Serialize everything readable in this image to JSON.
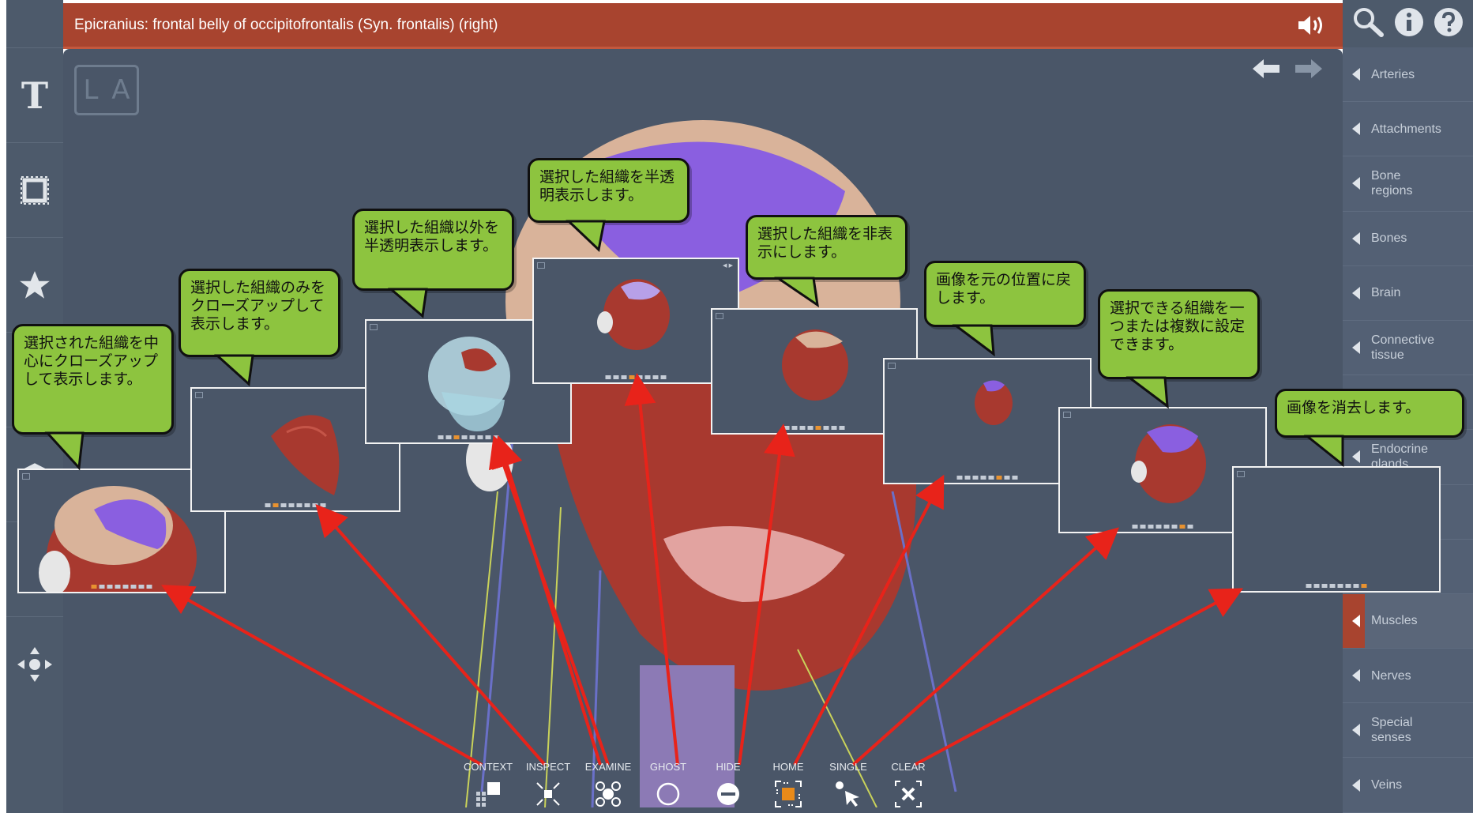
{
  "header": {
    "title": "Epicranius: frontal belly of occipitofrontalis (Syn. frontalis) (right)",
    "sound_icon": "speaker-icon"
  },
  "top_icons": [
    "search-icon",
    "info-icon",
    "help-icon"
  ],
  "left_toolbar": {
    "text_tool_label": "T",
    "items": [
      "text-icon",
      "frame-icon",
      "star-icon",
      "eye-icon",
      "layers-icon",
      "share-icon",
      "move-icon"
    ]
  },
  "viewport": {
    "badge": {
      "left": "L",
      "right": "A"
    }
  },
  "categories": [
    {
      "label": "Arteries"
    },
    {
      "label": "Attachments"
    },
    {
      "label": "Bone regions"
    },
    {
      "label": "Bones"
    },
    {
      "label": "Brain"
    },
    {
      "label": "Connective tissue"
    },
    {
      "label": ""
    },
    {
      "label": "Endocrine glands"
    },
    {
      "label": ""
    },
    {
      "label": ""
    },
    {
      "label": "Muscles"
    },
    {
      "label": "Nerves"
    },
    {
      "label": "Special senses"
    },
    {
      "label": "Veins"
    }
  ],
  "active_category": "Muscles",
  "callouts": {
    "context": "選択された組織を中心にクローズアップして表示します。",
    "inspect": "選択した組織のみをクローズアップして表示します。",
    "examine": "選択した組織以外を半透明表示します。",
    "ghost": "選択した組織を半透明表示します。",
    "hide": "選択した組織を非表示にします。",
    "home": "画像を元の位置に戻します。",
    "single": "選択できる組織を一つまたは複数に設定できます。",
    "clear": "画像を消去します。"
  },
  "toolbar": {
    "context": "CONTEXT",
    "inspect": "INSPECT",
    "examine": "EXAMINE",
    "ghost": "GHOST",
    "hide": "HIDE",
    "home": "HOME",
    "single": "SINGLE",
    "clear": "CLEAR"
  },
  "colors": {
    "title_bar": "#a8442f",
    "viewport": "#4a5668",
    "callout": "#8dc43f",
    "arrow": "#e8231a",
    "muscle": "#a8392f",
    "highlight": "#8a5fe0",
    "active_tool": "#e88a1a"
  }
}
